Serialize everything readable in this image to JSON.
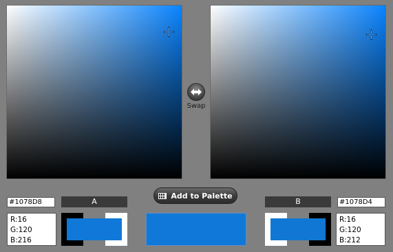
{
  "colors": {
    "color_a": "#1078D8",
    "color_b": "#1078D4",
    "hue_a": "#0a84ff",
    "hue_b": "#0a84ff",
    "strip_black": "#000000",
    "strip_white": "#ffffff",
    "strip_gray": "#808080"
  },
  "swap": {
    "label": "Swap",
    "icon": "swap-arrows-icon"
  },
  "add_to_palette": {
    "label": "Add to Palette",
    "icon": "palette-grid-icon"
  },
  "panel_a": {
    "label": "A",
    "hex": "#1078D8",
    "rgb": {
      "r": "R:16",
      "g": "G:120",
      "b": "B:216"
    }
  },
  "panel_b": {
    "label": "B",
    "hex": "#1078D4",
    "rgb": {
      "r": "R:16",
      "g": "G:120",
      "b": "B:212"
    }
  }
}
